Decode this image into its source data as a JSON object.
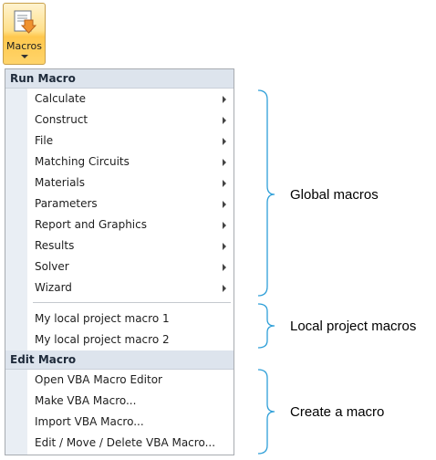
{
  "ribbon": {
    "macros_label": "Macros",
    "icon": "macros-scroll-icon",
    "accent": "#ffd46a"
  },
  "menu": {
    "run_macro_header": "Run Macro",
    "global_items": [
      {
        "label": "Calculate"
      },
      {
        "label": "Construct"
      },
      {
        "label": "File"
      },
      {
        "label": "Matching Circuits"
      },
      {
        "label": "Materials"
      },
      {
        "label": "Parameters"
      },
      {
        "label": "Report and Graphics"
      },
      {
        "label": "Results"
      },
      {
        "label": "Solver"
      },
      {
        "label": "Wizard"
      }
    ],
    "local_items": [
      {
        "label": "My local project macro 1"
      },
      {
        "label": "My local project macro 2"
      }
    ],
    "edit_macro_header": "Edit Macro",
    "edit_items": [
      {
        "label": "Open VBA Macro Editor"
      },
      {
        "label": "Make VBA Macro..."
      },
      {
        "label": "Import VBA Macro..."
      },
      {
        "label": "Edit / Move / Delete VBA Macro..."
      }
    ]
  },
  "annotations": {
    "global": "Global macros",
    "local": "Local project macros",
    "create": "Create a macro",
    "bracket_color": "#2e9fd8"
  }
}
